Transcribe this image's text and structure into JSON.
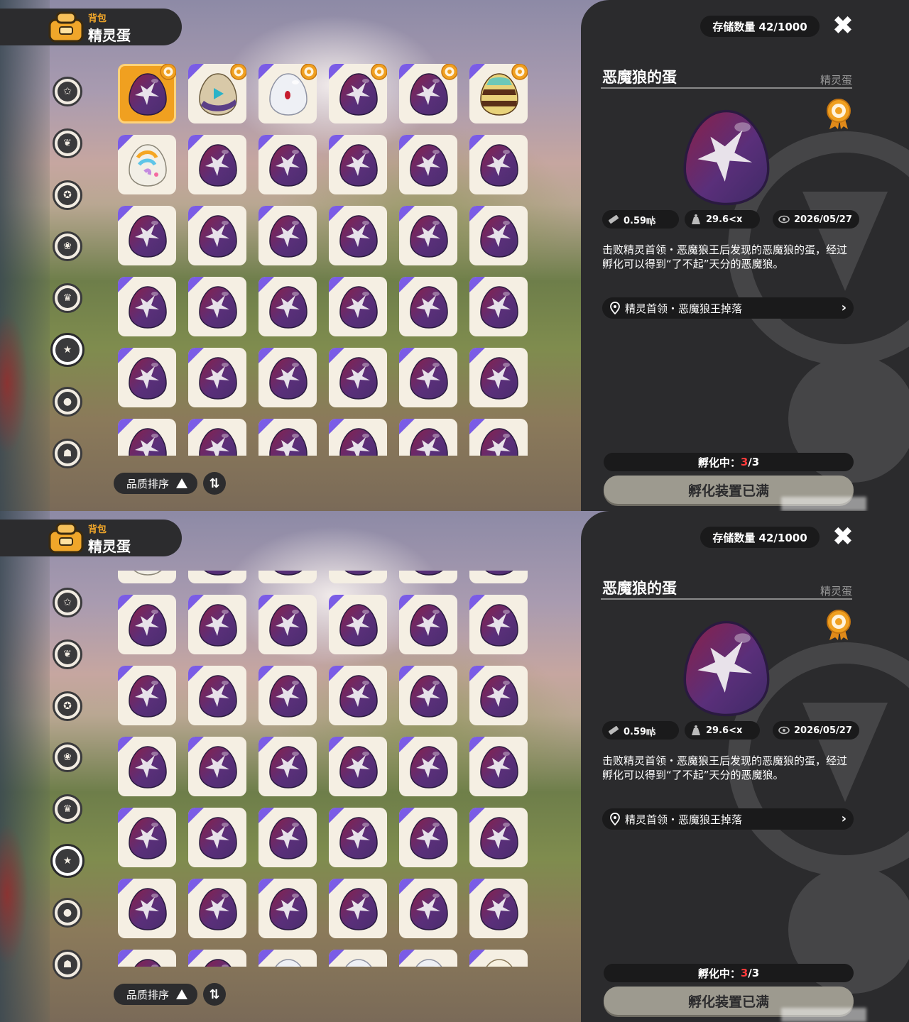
{
  "header": {
    "sub_label": "背包",
    "title": "精灵蛋"
  },
  "categories": [
    {
      "name": "cat-star-icon",
      "glyph": "✩"
    },
    {
      "name": "cat-leaf-icon",
      "glyph": "❦"
    },
    {
      "name": "cat-badge-icon",
      "glyph": "✪"
    },
    {
      "name": "cat-petal-icon",
      "glyph": "❀"
    },
    {
      "name": "cat-crown-icon",
      "glyph": "♛"
    },
    {
      "name": "cat-egg-icon",
      "glyph": "★"
    },
    {
      "name": "cat-acorn-icon",
      "glyph": "●"
    },
    {
      "name": "cat-sofa-icon",
      "glyph": "☗"
    }
  ],
  "active_category_index": 5,
  "sort": {
    "label": "品质排序",
    "toggle_glyph": "⇅"
  },
  "panel": {
    "storage_label": "存储数量 42/1000",
    "close_glyph": "✖",
    "item_name": "恶魔狼的蛋",
    "item_type": "精灵蛋",
    "stats": {
      "size": "0.59㎧",
      "weight": "29.6<x",
      "date": "2026/05/27"
    },
    "description": "击败精灵首领・恶魔狼王后发现的恶魔狼的蛋，经过孵化可以得到“了不起”天分的恶魔狼。",
    "source": "精灵首领・恶魔狼王掉落",
    "source_chevron": "›",
    "hatch_label": "孵化中：",
    "hatch_current": "3",
    "hatch_total": "/3",
    "hatch_button": "孵化装置已满"
  },
  "inventory": {
    "columns": 6,
    "items": [
      "wolf",
      "tan",
      "white",
      "wolf",
      "wolf",
      "striped",
      "rainbow",
      "wolf",
      "wolf",
      "wolf",
      "wolf",
      "wolf",
      "wolf",
      "wolf",
      "wolf",
      "wolf",
      "wolf",
      "wolf",
      "wolf",
      "wolf",
      "wolf",
      "wolf",
      "wolf",
      "wolf",
      "wolf",
      "wolf",
      "wolf",
      "wolf",
      "wolf",
      "wolf",
      "wolf",
      "wolf",
      "wolf",
      "wolf",
      "wolf",
      "wolf",
      "wolf",
      "wolf",
      "wolf",
      "wolf",
      "wolf",
      "wolf",
      "wolf",
      "wolf",
      "white",
      "white",
      "white",
      "star"
    ],
    "badged_count": 6,
    "selected_index": 0
  },
  "views": [
    {
      "id": "top",
      "scroll_rows": 0
    },
    {
      "id": "bottom",
      "scroll_rows": 1.72
    }
  ],
  "colors": {
    "panel_bg": "#2b2b2d",
    "accent_orange": "#f0a020",
    "hatch_red": "#ff3b3b",
    "egg_purple": "#4b2e6e",
    "egg_maroon": "#8a2048",
    "rarity_corner": "#7a5ce6"
  }
}
